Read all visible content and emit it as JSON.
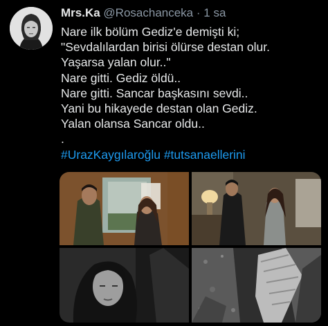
{
  "tweet": {
    "display_name": "Mrs.Ka",
    "handle": "@Rosachanceka",
    "separator": "·",
    "time": "1 sa",
    "lines": [
      "Nare ilk bölüm Gediz'e demişti ki;",
      "\"Sevdalılardan birisi ölürse destan olur.",
      "Yaşarsa yalan olur..\"",
      "Nare gitti. Gediz öldü..",
      "Nare gitti. Sancar başkasını sevdi..",
      "Yani bu hikayede destan olan Gediz.",
      "Yalan olansa Sancar oldu..",
      "."
    ],
    "hashtags": "#UrazKaygılaroğlu #tutsanaellerini"
  },
  "media": {
    "image_count": 4,
    "images": [
      {
        "name": "photo-couple-at-door",
        "tone": "color"
      },
      {
        "name": "photo-couple-in-room",
        "tone": "color"
      },
      {
        "name": "photo-woman-closeup",
        "tone": "bw"
      },
      {
        "name": "photo-grave-digging",
        "tone": "bw"
      }
    ]
  },
  "colors": {
    "background": "#000000",
    "text": "#e7e9ea",
    "muted": "#8b98a5",
    "link": "#1d9bf0"
  }
}
